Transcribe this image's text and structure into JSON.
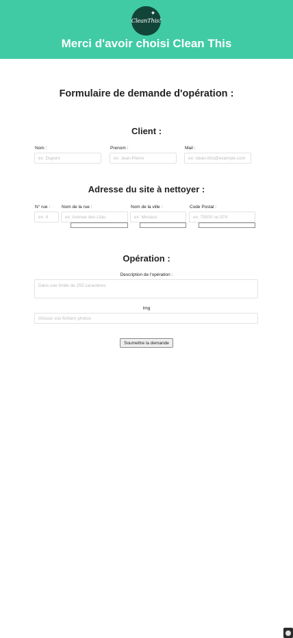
{
  "header": {
    "logo_text": "CleanThis!",
    "title": "Merci d'avoir choisi Clean This",
    "bg_color": "#40cba5",
    "logo_color": "#124538"
  },
  "form": {
    "title": "Formulaire de demande d'opération :",
    "client": {
      "title": "Client :",
      "nom_label": "Nom :",
      "nom_placeholder": "ex: Dupont",
      "prenom_label": "Prenom :",
      "prenom_placeholder": "ex: Jean-Pierre",
      "mail_label": "Mail :",
      "mail_placeholder": "ex: clean.this@example.com"
    },
    "adresse": {
      "title": "Adresse du site à nettoyer :",
      "num_label": "N° rue :",
      "num_placeholder": "ex: 4",
      "rue_label": "Nom de la rue :",
      "rue_placeholder": "ex: Avenue des Lilas",
      "ville_label": "Nom de la ville :",
      "ville_placeholder": "ex: Monaco",
      "cp_label": "Code Postal :",
      "cp_placeholder": "ex: 75000 ou 974"
    },
    "operation": {
      "title": "Opération :",
      "description_label": "Description de l'opération :",
      "description_placeholder": "Dans une limite de 255 caractères",
      "img_label": "Img",
      "img_placeholder": "Glissez vos fichiers photos"
    },
    "submit_label": "Soumettre la demande"
  }
}
